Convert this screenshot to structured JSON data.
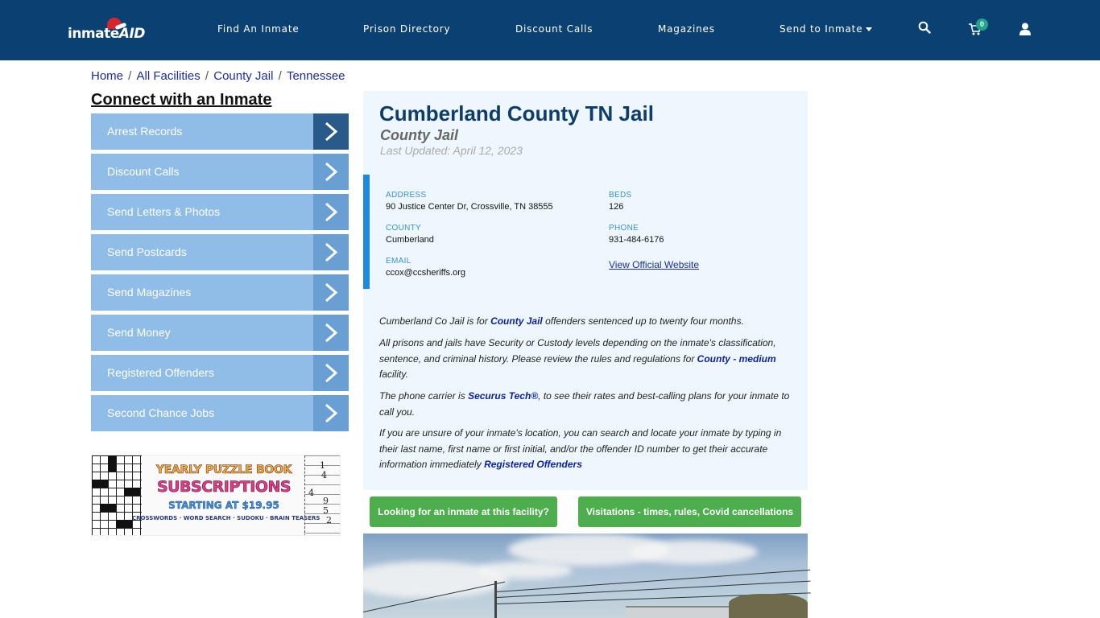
{
  "header": {
    "logo": {
      "text_main": "inmate",
      "text_accent": "AID"
    },
    "nav": [
      {
        "label": "Find An Inmate"
      },
      {
        "label": "Prison Directory"
      },
      {
        "label": "Discount Calls"
      },
      {
        "label": "Magazines"
      },
      {
        "label": "Send to Inmate",
        "has_dropdown": true
      }
    ],
    "icons": {
      "search": "search-icon",
      "cart": "cart-icon",
      "user": "user-icon"
    },
    "cart_count": "0",
    "colors": {
      "bar": "#0b4172",
      "badge": "#20a58a"
    }
  },
  "breadcrumb": [
    {
      "label": "Home"
    },
    {
      "label": "All Facilities"
    },
    {
      "label": "County Jail"
    },
    {
      "label": "Tennessee"
    }
  ],
  "sidebar": {
    "title": "Connect with an Inmate",
    "items": [
      {
        "label": "Arrest Records",
        "active": true
      },
      {
        "label": "Discount Calls"
      },
      {
        "label": "Send Letters & Photos"
      },
      {
        "label": "Send Postcards"
      },
      {
        "label": "Send Magazines"
      },
      {
        "label": "Send Money"
      },
      {
        "label": "Registered Offenders"
      },
      {
        "label": "Second Chance Jobs"
      }
    ],
    "ad": {
      "line1": "YEARLY PUZZLE BOOK",
      "line2": "SUBSCRIPTIONS",
      "line3": "STARTING AT $19.95",
      "line4": "CROSSWORDS · WORD SEARCH · SUDOKU · BRAIN TEASERS",
      "sudoku_digits": [
        "1",
        "4",
        "4",
        "9",
        "5",
        "2"
      ]
    }
  },
  "facility": {
    "name": "Cumberland County TN Jail",
    "type": "County Jail",
    "last_updated": "Last Updated: April 12, 2023",
    "info": {
      "address_label": "ADDRESS",
      "address": "90 Justice Center Dr, Crossville, TN 38555",
      "beds_label": "BEDS",
      "beds": "126",
      "county_label": "COUNTY",
      "county": "Cumberland",
      "phone_label": "PHONE",
      "phone": "931-484-6176",
      "email_label": "EMAIL",
      "email": "ccox@ccsheriffs.org",
      "website_link": "View Official Website"
    },
    "paragraphs": {
      "p1_a": "Cumberland Co Jail is for ",
      "p1_link": "County Jail",
      "p1_b": " offenders sentenced up to twenty four months.",
      "p2_a": "All prisons and jails have Security or Custody levels depending on the inmate's classification, sentence, and criminal history. Please review the rules and regulations for ",
      "p2_link": "County - medium",
      "p2_b": " facility.",
      "p3_a": "The phone carrier is ",
      "p3_link": "Securus Tech®",
      "p3_b": ", to see their rates and best-calling plans for your inmate to call you.",
      "p4_a": "If you are unsure of your inmate's location, you can search and locate your inmate by typing in their last name, first name or first initial, and/or the offender ID number to get their accurate information immediately ",
      "p4_link": "Registered Offenders"
    },
    "buttons": {
      "find_inmate": "Looking for an inmate at this facility?",
      "visitations": "Visitations - times, rules, Covid cancellations"
    },
    "colors": {
      "title": "#0e3d6b",
      "panel": "#eef7fd",
      "accent_bar": "#1a8be0",
      "button": "#4cae4c"
    }
  }
}
